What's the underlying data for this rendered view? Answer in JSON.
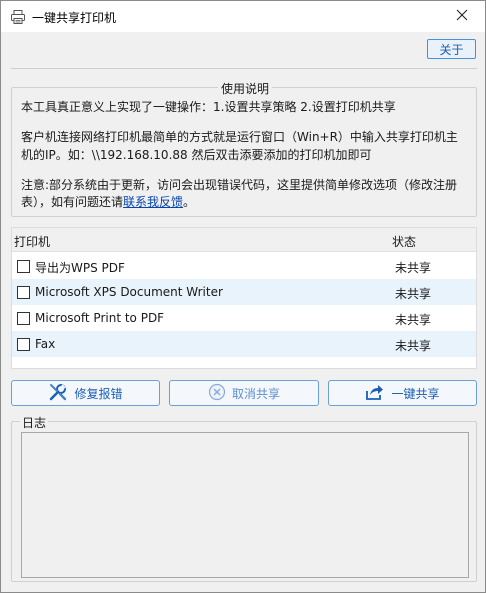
{
  "window": {
    "title": "一键共享打印机",
    "about_label": "关于"
  },
  "usage": {
    "title": "使用说明",
    "line1": "本工具真正意义上实现了一键操作：1.设置共享策略 2.设置打印机共享",
    "line2": "客户机连接网络打印机最简单的方式就是运行窗口（Win+R）中输入共享打印机主",
    "line3": "机的IP。如：\\\\192.168.10.88 然后双击添要添加的打印机加即可",
    "line4": "注意:部分系统由于更新，访问会出现错误代码，这里提供简单修改选项（修改注册",
    "line5_prefix": "表），如有问题还请",
    "line5_link": "联系我反馈",
    "line5_suffix": "。"
  },
  "printers": {
    "col_name": "打印机",
    "col_status": "状态",
    "rows": [
      {
        "name": "导出为WPS PDF",
        "status": "未共享"
      },
      {
        "name": "Microsoft XPS Document Writer",
        "status": "未共享"
      },
      {
        "name": "Microsoft Print to PDF",
        "status": "未共享"
      },
      {
        "name": "Fax",
        "status": "未共享"
      }
    ]
  },
  "actions": {
    "repair_label": "修复报错",
    "cancel_label": "取消共享",
    "share_label": "一键共享"
  },
  "log": {
    "title": "日志",
    "content": ""
  },
  "icons": {
    "title": "printer-icon",
    "close": "close-icon",
    "repair": "wrench-icon",
    "cancel": "cancel-circle-icon",
    "share": "share-arrow-icon"
  },
  "colors": {
    "accent": "#1a5fb4",
    "row_alt": "#e8f3fb",
    "button_border": "#6a9fd8"
  }
}
